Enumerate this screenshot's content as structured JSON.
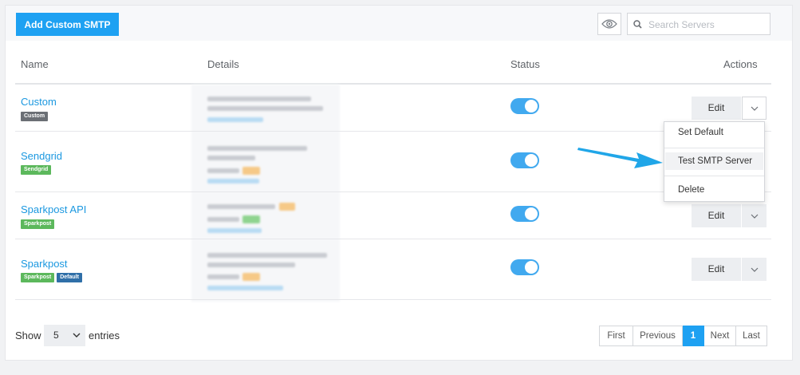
{
  "toolbar": {
    "add_label": "Add Custom SMTP",
    "search_placeholder": "Search Servers"
  },
  "table": {
    "headers": {
      "name": "Name",
      "details": "Details",
      "status": "Status",
      "actions": "Actions"
    },
    "rows": [
      {
        "name": "Custom",
        "tags": [
          "Custom"
        ],
        "status": "on",
        "edit": "Edit"
      },
      {
        "name": "Sendgrid",
        "tags": [
          "Sendgrid"
        ],
        "status": "on",
        "edit": "Edit"
      },
      {
        "name": "Sparkpost API",
        "tags": [
          "Sparkpost"
        ],
        "status": "on",
        "edit": "Edit"
      },
      {
        "name": "Sparkpost",
        "tags": [
          "Sparkpost",
          "Default"
        ],
        "status": "on",
        "edit": "Edit"
      }
    ]
  },
  "dropdown_menu": {
    "items": [
      "Set Default",
      "Test SMTP Server",
      "Delete"
    ],
    "highlighted": "Test SMTP Server"
  },
  "footer": {
    "show_label": "Show",
    "entries_value": "5",
    "entries_label": "entries",
    "pagination": [
      "First",
      "Previous",
      "1",
      "Next",
      "Last"
    ],
    "current_page": "1"
  },
  "colors": {
    "accent": "#1ea1f2",
    "link": "#1b98e0",
    "toggle_on": "#41a9ef",
    "tag_gray": "#6b6f75",
    "tag_green": "#5cb85c",
    "tag_blue": "#2f6fa8",
    "annotation_arrow": "#20a6e8"
  },
  "icons": {
    "visibility": "eye-icon",
    "search": "search-icon",
    "dropdown": "chevron-down-icon",
    "annotation": "arrow-icon"
  }
}
